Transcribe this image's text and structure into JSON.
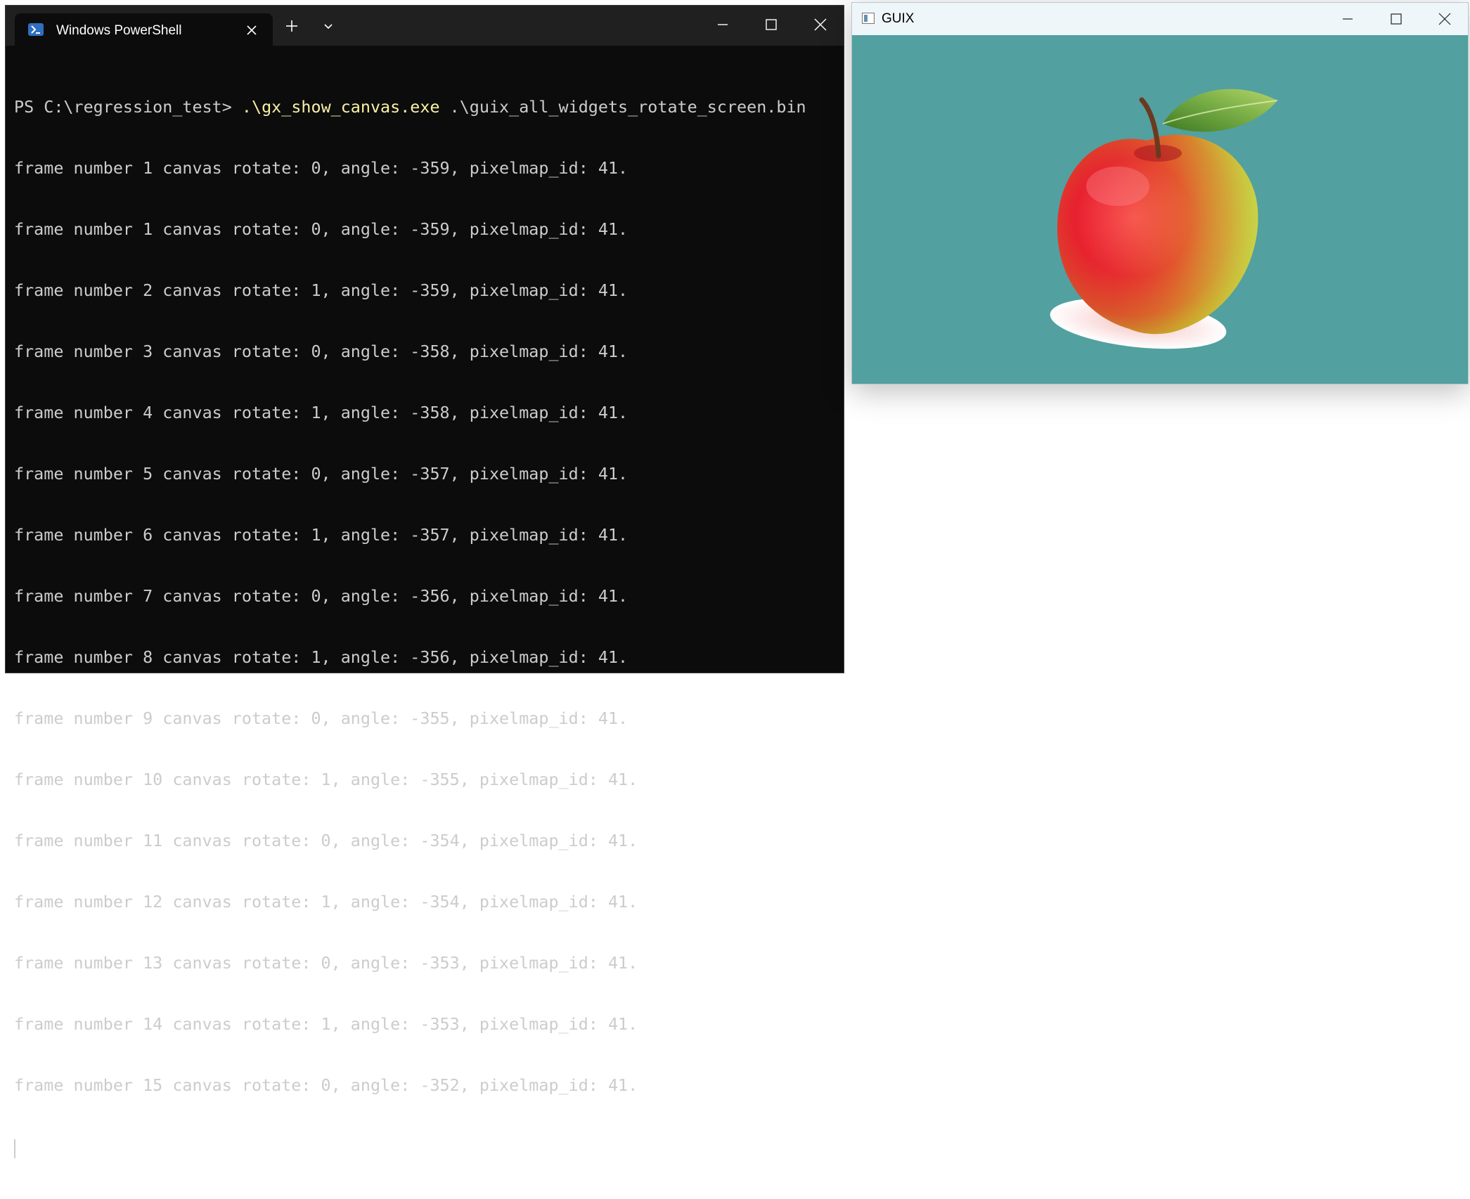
{
  "terminal": {
    "tab_title": "Windows PowerShell",
    "icons": {
      "tab": "powershell-icon",
      "close_tab": "close-icon",
      "new_tab": "plus-icon",
      "dropdown": "chevron-down-icon",
      "minimize": "minimize-icon",
      "maximize": "maximize-icon",
      "close": "close-icon"
    },
    "prompt": "PS C:\\regression_test> ",
    "command_exe": ".\\gx_show_canvas.exe",
    "command_arg": " .\\guix_all_widgets_rotate_screen.bin",
    "output_lines": [
      "frame number 1 canvas rotate: 0, angle: -359, pixelmap_id: 41.",
      "frame number 1 canvas rotate: 0, angle: -359, pixelmap_id: 41.",
      "frame number 2 canvas rotate: 1, angle: -359, pixelmap_id: 41.",
      "frame number 3 canvas rotate: 0, angle: -358, pixelmap_id: 41.",
      "frame number 4 canvas rotate: 1, angle: -358, pixelmap_id: 41.",
      "frame number 5 canvas rotate: 0, angle: -357, pixelmap_id: 41.",
      "frame number 6 canvas rotate: 1, angle: -357, pixelmap_id: 41.",
      "frame number 7 canvas rotate: 0, angle: -356, pixelmap_id: 41.",
      "frame number 8 canvas rotate: 1, angle: -356, pixelmap_id: 41.",
      "frame number 9 canvas rotate: 0, angle: -355, pixelmap_id: 41.",
      "frame number 10 canvas rotate: 1, angle: -355, pixelmap_id: 41.",
      "frame number 11 canvas rotate: 0, angle: -354, pixelmap_id: 41.",
      "frame number 12 canvas rotate: 1, angle: -354, pixelmap_id: 41.",
      "frame number 13 canvas rotate: 0, angle: -353, pixelmap_id: 41.",
      "frame number 14 canvas rotate: 1, angle: -353, pixelmap_id: 41.",
      "frame number 15 canvas rotate: 0, angle: -352, pixelmap_id: 41."
    ],
    "colors": {
      "background": "#0c0c0c",
      "text": "#cccccc",
      "command": "#f9f1a5",
      "titlebar": "#202020"
    }
  },
  "guix_window": {
    "title": "GUIX",
    "icons": {
      "app": "guix-app-icon",
      "minimize": "minimize-icon",
      "maximize": "maximize-icon",
      "close": "close-icon",
      "image": "apple-image"
    },
    "colors": {
      "canvas": "#52a0a0",
      "titlebar": "#eef6fa"
    }
  }
}
